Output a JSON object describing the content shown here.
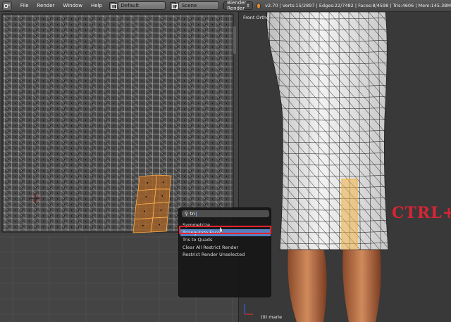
{
  "header": {
    "menu": [
      "File",
      "Render",
      "Window",
      "Help"
    ],
    "layout_value": "Default",
    "scene_value": "Scene",
    "render_engine": "Blender Render",
    "stats": "v2.70 | Verts:15/2897 | Edges:22/7482 | Faces:8/4598 | Tris:4606 | Mem:145.38M"
  },
  "viewport": {
    "view_label": "Front Ortho",
    "object_label": "(0) marie",
    "overlay_text": "CTRL+T"
  },
  "operator_search": {
    "query": "tri",
    "results": [
      {
        "label": "Symmetrize",
        "highlighted": false
      },
      {
        "label": "Triangulate Faces",
        "highlighted": true
      },
      {
        "label": "Tris to Quads",
        "highlighted": false
      },
      {
        "label": "Clear All Restrict Render",
        "highlighted": false
      },
      {
        "label": "Restrict Render Unselected",
        "highlighted": false
      }
    ]
  },
  "colors": {
    "selection_orange": "#d08a3a",
    "highlight_blue": "#5680c2",
    "annotation_red": "#e5232e"
  }
}
